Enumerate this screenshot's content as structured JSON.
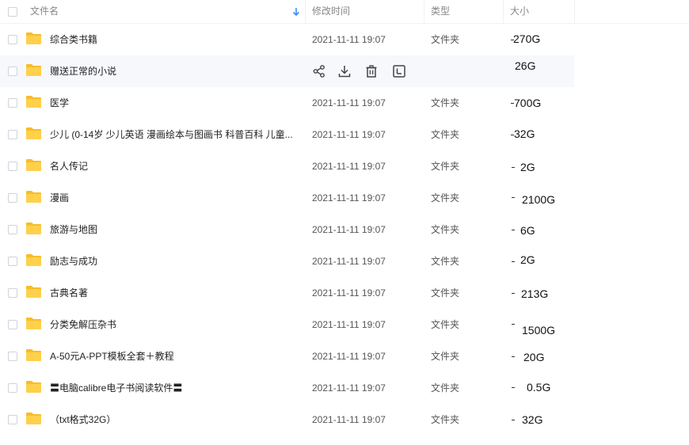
{
  "header": {
    "name_label": "文件名",
    "modified_label": "修改时间",
    "type_label": "类型",
    "size_label": "大小"
  },
  "rows": [
    {
      "name": "综合类书籍",
      "date": "2021-11-11 19:07",
      "type": "文件夹",
      "size": "270G"
    },
    {
      "name": "赠送正常的小说",
      "date": "",
      "type": "",
      "size": "26G"
    },
    {
      "name": "医学",
      "date": "2021-11-11 19:07",
      "type": "文件夹",
      "size": "700G"
    },
    {
      "name": "少儿 (0-14岁 少儿英语 漫画绘本与图画书 科普百科 儿童...",
      "date": "2021-11-11 19:07",
      "type": "文件夹",
      "size": "32G"
    },
    {
      "name": "名人传记",
      "date": "2021-11-11 19:07",
      "type": "文件夹",
      "size": "2G"
    },
    {
      "name": "漫画",
      "date": "2021-11-11 19:07",
      "type": "文件夹",
      "size": "2100G"
    },
    {
      "name": "旅游与地图",
      "date": "2021-11-11 19:07",
      "type": "文件夹",
      "size": "6G"
    },
    {
      "name": "励志与成功",
      "date": "2021-11-11 19:07",
      "type": "文件夹",
      "size": "2G"
    },
    {
      "name": "古典名著",
      "date": "2021-11-11 19:07",
      "type": "文件夹",
      "size": "213G"
    },
    {
      "name": "分类免解压杂书",
      "date": "2021-11-11 19:07",
      "type": "文件夹",
      "size": "1500G"
    },
    {
      "name": "A-50元A-PPT模板全套＋教程",
      "date": "2021-11-11 19:07",
      "type": "文件夹",
      "size": "20G"
    },
    {
      "name": "〓电脑calibre电子书阅读软件〓",
      "date": "2021-11-11 19:07",
      "type": "文件夹",
      "size": "0.5G"
    },
    {
      "name": "（txt格式32G）",
      "date": "2021-11-11 19:07",
      "type": "文件夹",
      "size": "32G"
    }
  ],
  "hover_actions": [
    "share-icon",
    "download-icon",
    "delete-icon",
    "more-icon"
  ],
  "colors": {
    "folder": "#ffd04b",
    "folder_tab": "#f7bd2a",
    "sort_arrow": "#3b8cff",
    "hover_row": "#f6f8fc"
  }
}
